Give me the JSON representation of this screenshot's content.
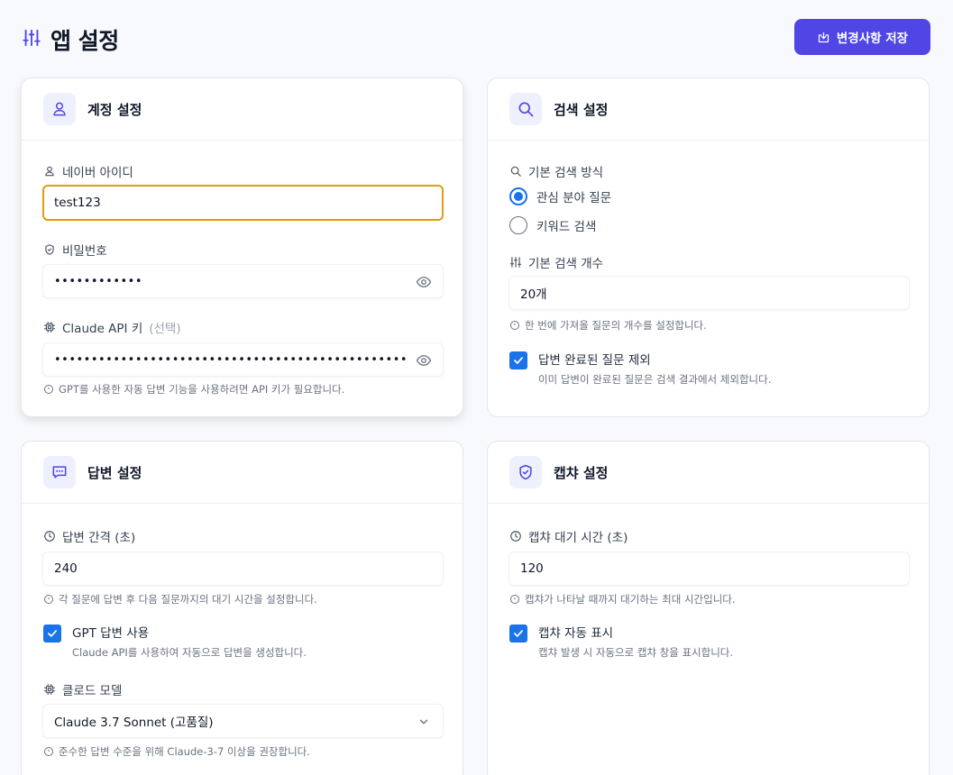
{
  "header": {
    "title": "앱 설정",
    "save_label": "변경사항 저장"
  },
  "account": {
    "title": "계정 설정",
    "naver_label": "네이버 아이디",
    "naver_value": "test123",
    "password_label": "비밀번호",
    "password_value": "••••••••••••",
    "api_label": "Claude API 키",
    "api_optional": "(선택)",
    "api_value": "•••••••••••••••••••••••••••••••••••••••••••••••••••••••••••••••••••••••••••",
    "api_hint": "GPT를 사용한 자동 답변 기능을 사용하려면 API 키가 필요합니다."
  },
  "search": {
    "title": "검색 설정",
    "method_label": "기본 검색 방식",
    "options": [
      "관심 분야 질문",
      "키워드 검색"
    ],
    "selected_option": "관심 분야 질문",
    "count_label": "기본 검색 개수",
    "count_value": "20개",
    "count_hint": "한 번에 가져올 질문의 개수를 설정합니다.",
    "exclude_label": "답변 완료된 질문 제외",
    "exclude_desc": "이미 답변이 완료된 질문은 검색 결과에서 제외합니다.",
    "exclude_checked": true
  },
  "answer": {
    "title": "답변 설정",
    "interval_label": "답변 간격 (초)",
    "interval_value": "240",
    "interval_hint": "각 질문에 답변 후 다음 질문까지의 대기 시간을 설정합니다.",
    "gpt_label": "GPT 답변 사용",
    "gpt_desc": "Claude API를 사용하여 자동으로 답변을 생성합니다.",
    "gpt_checked": true,
    "model_label": "클로드 모델",
    "model_value": "Claude 3.7 Sonnet (고품질)",
    "model_hint": "준수한 답변 수준을 위해 Claude-3-7 이상을 권장합니다."
  },
  "captcha": {
    "title": "캡챠 설정",
    "wait_label": "캡챠 대기 시간 (초)",
    "wait_value": "120",
    "wait_hint": "캡챠가 나타날 때까지 대기하는 최대 시간입니다.",
    "auto_label": "캡챠 자동 표시",
    "auto_desc": "캡챠 발생 시 자동으로 캡챠 창을 표시합니다.",
    "auto_checked": true
  },
  "colors": {
    "accent": "#4f46e5",
    "check": "#1a73e8",
    "focus_border": "#e39c13"
  }
}
